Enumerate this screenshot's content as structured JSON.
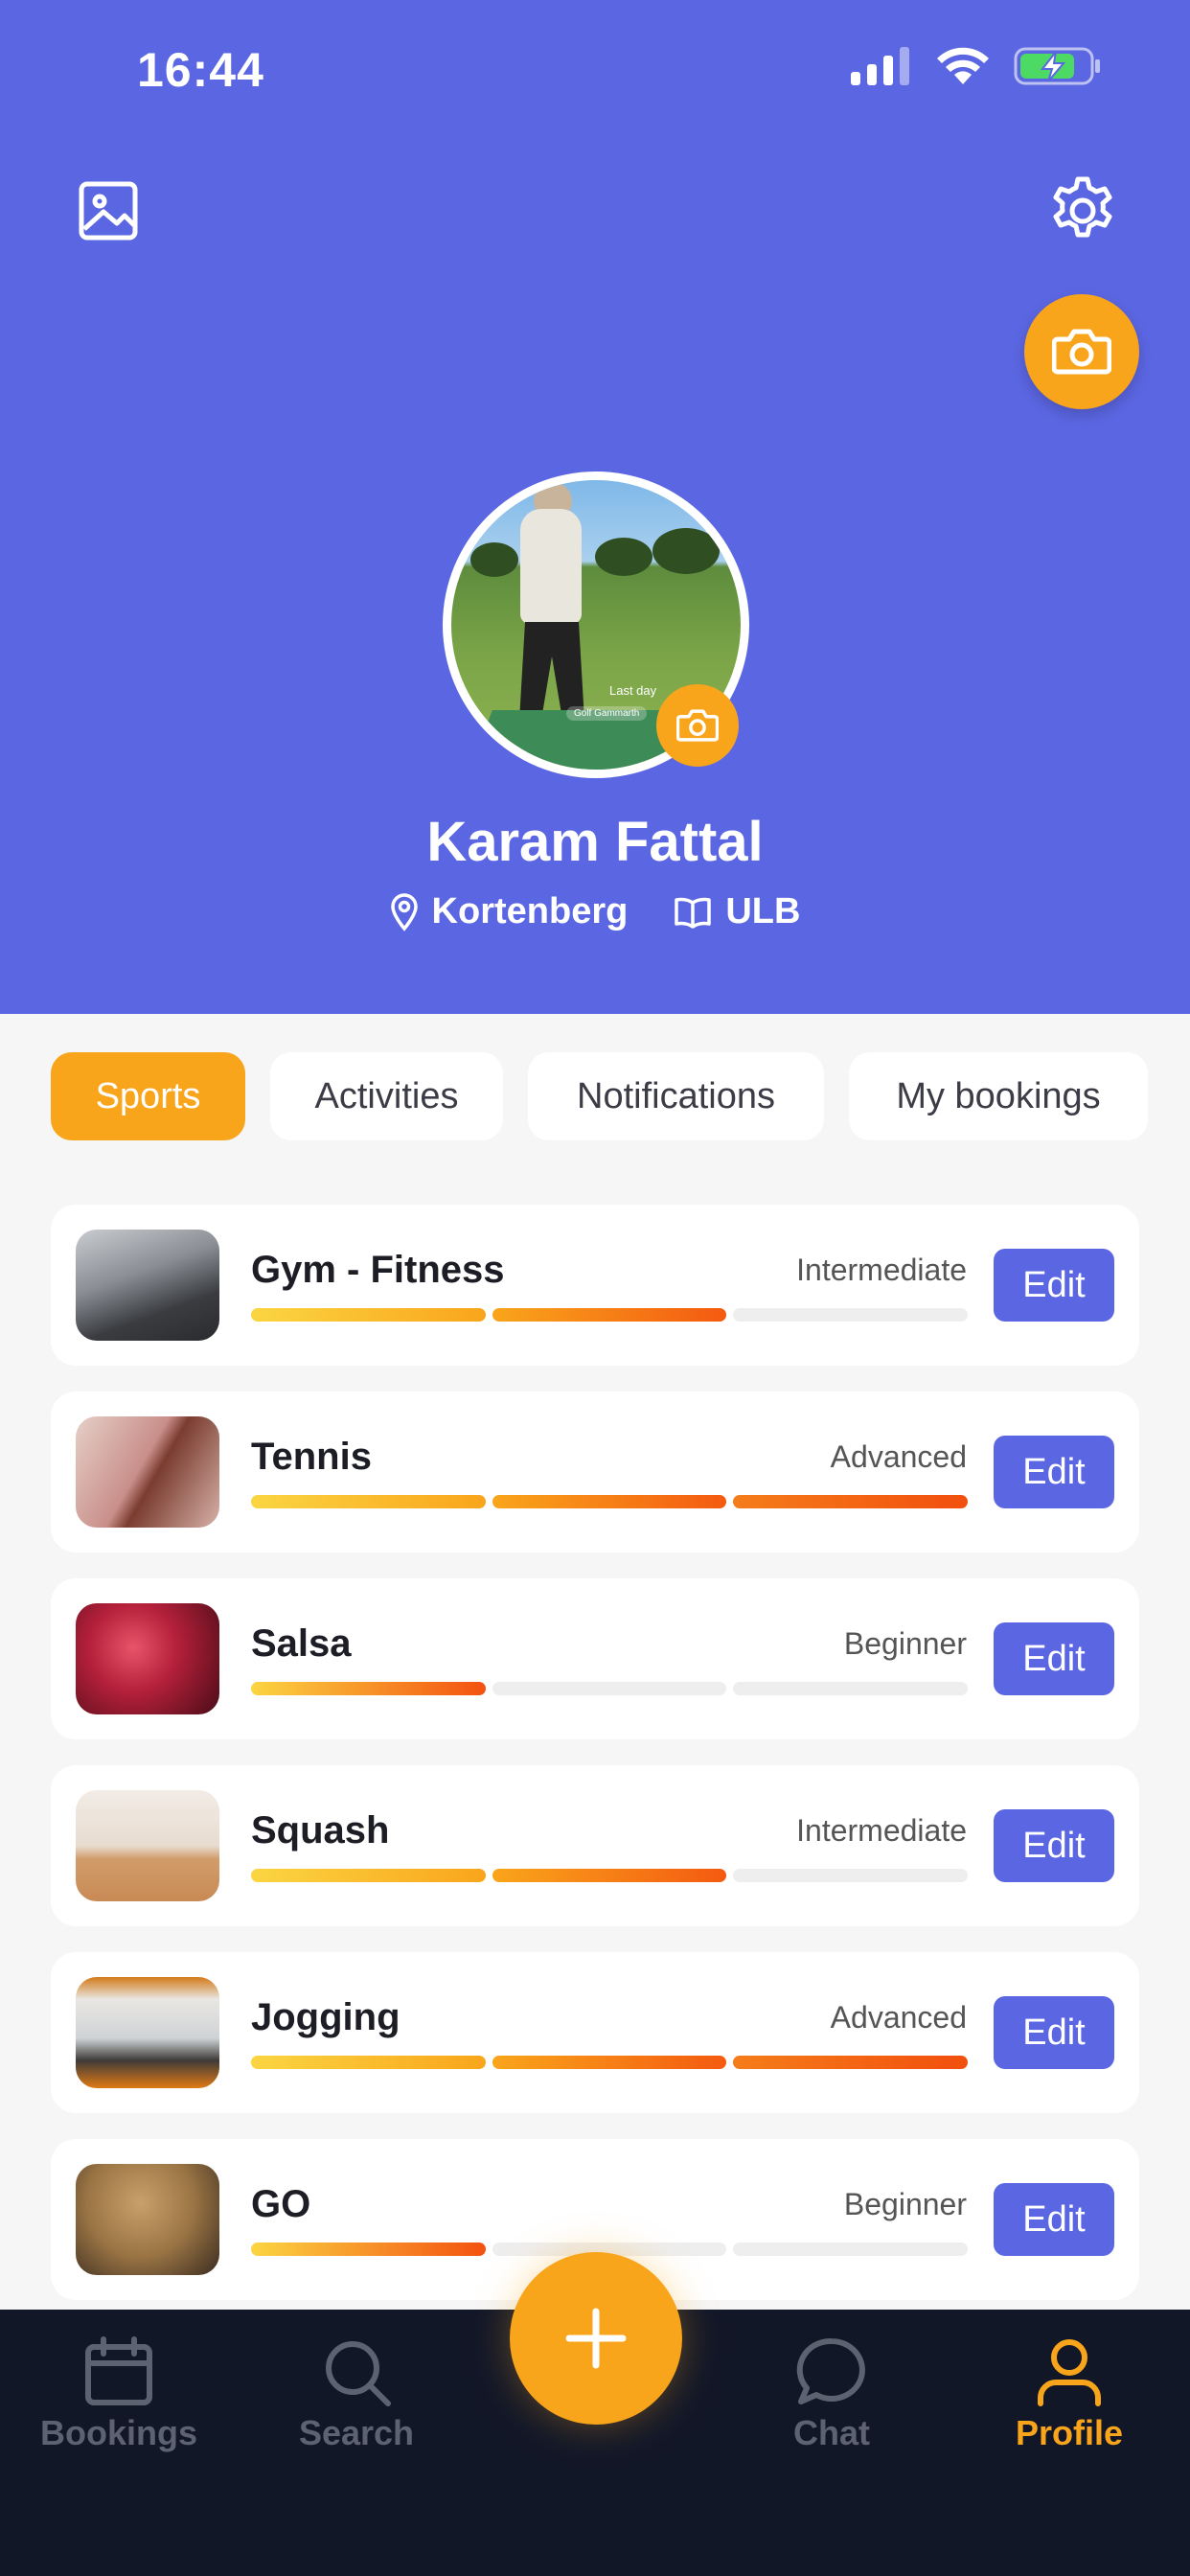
{
  "status_bar": {
    "time": "16:44"
  },
  "profile": {
    "name": "Karam Fattal",
    "location": "Kortenberg",
    "school": "ULB",
    "avatar_caption": "Last day",
    "avatar_place": "Golf Gammarth"
  },
  "tabs": [
    {
      "label": "Sports",
      "active": true
    },
    {
      "label": "Activities",
      "active": false
    },
    {
      "label": "Notifications",
      "active": false
    },
    {
      "label": "My bookings",
      "active": false
    }
  ],
  "sports": [
    {
      "name": "Gym - Fitness",
      "level": "Intermediate",
      "level_value": 2,
      "edit": "Edit"
    },
    {
      "name": "Tennis",
      "level": "Advanced",
      "level_value": 3,
      "edit": "Edit"
    },
    {
      "name": "Salsa",
      "level": "Beginner",
      "level_value": 1,
      "edit": "Edit"
    },
    {
      "name": "Squash",
      "level": "Intermediate",
      "level_value": 2,
      "edit": "Edit"
    },
    {
      "name": "Jogging",
      "level": "Advanced",
      "level_value": 3,
      "edit": "Edit"
    },
    {
      "name": "GO",
      "level": "Beginner",
      "level_value": 1,
      "edit": "Edit"
    }
  ],
  "bottom_nav": [
    {
      "label": "Bookings",
      "icon": "calendar-icon",
      "active": false
    },
    {
      "label": "Search",
      "icon": "search-icon",
      "active": false
    },
    {
      "label": "Chat",
      "icon": "chat-icon",
      "active": false
    },
    {
      "label": "Profile",
      "icon": "profile-icon",
      "active": true
    }
  ],
  "colors": {
    "primary": "#5b66e2",
    "accent": "#f9a51b",
    "nav_bg": "#121728"
  }
}
